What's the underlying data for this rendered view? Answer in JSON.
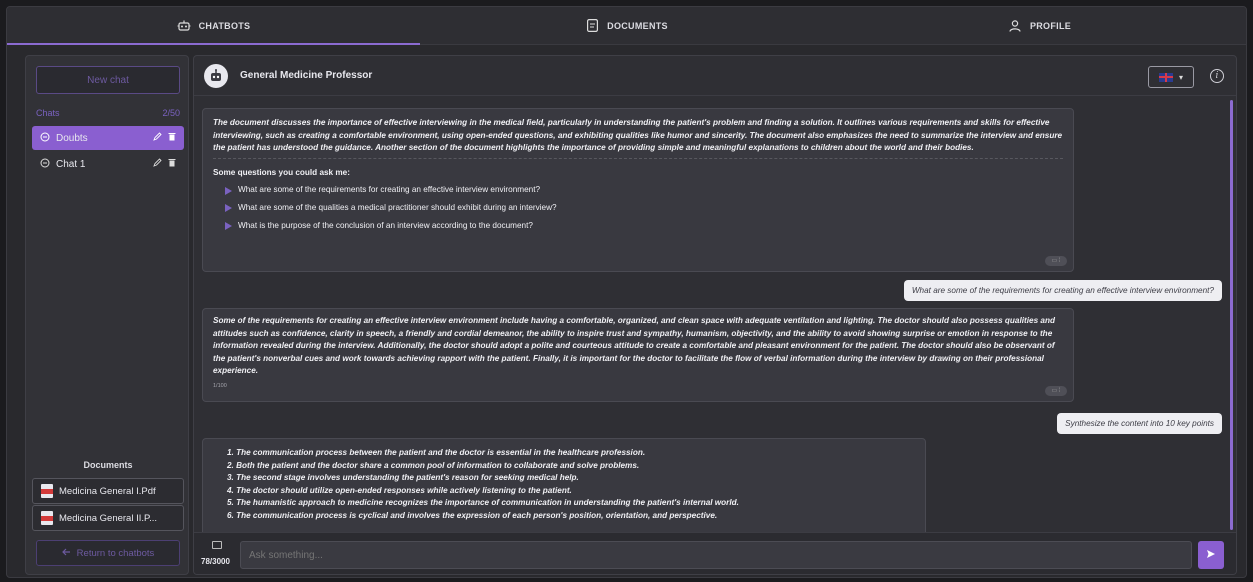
{
  "nav": {
    "tabs": [
      {
        "label": "CHATBOTS",
        "icon": "robot-icon",
        "active": true
      },
      {
        "label": "DOCUMENTS",
        "icon": "document-icon",
        "active": false
      },
      {
        "label": "PROFILE",
        "icon": "user-icon",
        "active": false
      }
    ]
  },
  "sidebar": {
    "new_chat": "New chat",
    "chats_label": "Chats",
    "chats_count": "2/50",
    "chats": [
      {
        "name": "Doubts",
        "active": true
      },
      {
        "name": "Chat 1",
        "active": false
      }
    ],
    "documents_label": "Documents",
    "documents": [
      {
        "name": "Medicina General I.Pdf"
      },
      {
        "name": "Medicina General II.P..."
      }
    ],
    "return_label": "Return to chatbots"
  },
  "main": {
    "bot_name": "General Medicine Professor",
    "language": "en-GB",
    "info_glyph": "i",
    "messages": {
      "summary": "The document discusses the importance of effective interviewing in the medical field, particularly in understanding the patient's problem and finding a solution. It outlines various requirements and skills for effective interviewing, such as creating a comfortable environment, using open-ended questions, and exhibiting qualities like humor and sincerity. The document also emphasizes the need to summarize the interview and ensure the patient has understood the guidance. Another section of the document highlights the importance of providing simple and meaningful explanations to children about the world and their bodies.",
      "suggest_header": "Some questions you could ask me:",
      "suggestions": [
        "What are some of the requirements for creating an effective interview environment?",
        "What are some of the qualities a medical practitioner should exhibit during an interview?",
        "What is the purpose of the conclusion of an interview according to the document?"
      ],
      "user_q1": "What are some of the requirements for creating an effective interview environment?",
      "answer1": "Some of the requirements for creating an effective interview environment include having a comfortable, organized, and clean space with adequate ventilation and lighting. The doctor should also possess qualities and attitudes such as confidence, clarity in speech, a friendly and cordial demeanor, the ability to inspire trust and sympathy, humanism, objectivity, and the ability to avoid showing surprise or emotion in response to the information revealed during the interview. Additionally, the doctor should adopt a polite and courteous attitude to create a comfortable and pleasant environment for the patient. The doctor should also be observant of the patient's nonverbal cues and work towards achieving rapport with the patient. Finally, it is important for the doctor to facilitate the flow of verbal information during the interview by drawing on their professional experience.",
      "answer1_counter": "1/100",
      "user_q2": "Synthesize the content into 10 key points",
      "points": [
        "1. The communication process between the patient and the doctor is essential in the healthcare profession.",
        "2. Both the patient and the doctor share a common pool of information to collaborate and solve problems.",
        "3. The second stage involves understanding the patient's reason for seeking medical help.",
        "4. The doctor should utilize open-ended responses while actively listening to the patient.",
        "5. The humanistic approach to medicine recognizes the importance of communication in understanding the patient's internal world.",
        "6. The communication process is cyclical and involves the expression of each person's position, orientation, and perspective."
      ]
    },
    "input": {
      "count": "78/3000",
      "placeholder": "Ask something..."
    }
  },
  "colors": {
    "accent": "#8a5fd0",
    "background": "#29292d",
    "bubble": "#393940"
  }
}
